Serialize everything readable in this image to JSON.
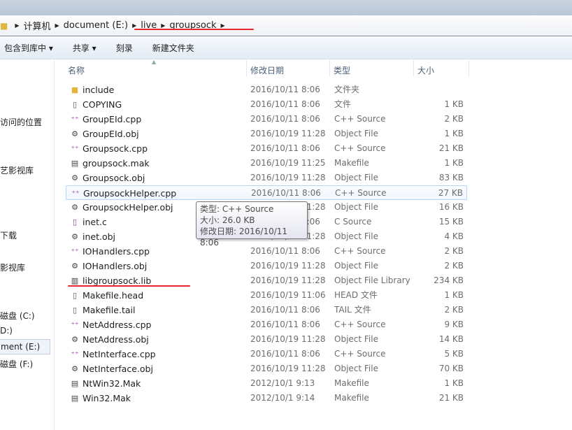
{
  "breadcrumb": [
    "计算机",
    "document (E:)",
    "live",
    "groupsock"
  ],
  "toolbar": {
    "include_library": "包含到库中 ▾",
    "share": "共享 ▾",
    "burn": "刻录",
    "new_folder": "新建文件夹"
  },
  "nav": [
    "访问的位置",
    "艺影视库",
    "下载",
    "影视库",
    "磁盘 (C:)",
    "D:)",
    "ment (E:)",
    "磁盘 (F:)"
  ],
  "columns": {
    "name": "名称",
    "date": "修改日期",
    "type": "类型",
    "size": "大小"
  },
  "files": [
    {
      "icon": "folder",
      "name": "include",
      "date": "2016/10/11 8:06",
      "type": "文件夹",
      "size": ""
    },
    {
      "icon": "file",
      "name": "COPYING",
      "date": "2016/10/11 8:06",
      "type": "文件",
      "size": "1 KB"
    },
    {
      "icon": "cpp",
      "name": "GroupEId.cpp",
      "date": "2016/10/11 8:06",
      "type": "C++ Source",
      "size": "2 KB"
    },
    {
      "icon": "obj",
      "name": "GroupEId.obj",
      "date": "2016/10/19 11:28",
      "type": "Object File",
      "size": "1 KB"
    },
    {
      "icon": "cpp",
      "name": "Groupsock.cpp",
      "date": "2016/10/11 8:06",
      "type": "C++ Source",
      "size": "21 KB"
    },
    {
      "icon": "mak",
      "name": "groupsock.mak",
      "date": "2016/10/19 11:25",
      "type": "Makefile",
      "size": "1 KB"
    },
    {
      "icon": "obj",
      "name": "Groupsock.obj",
      "date": "2016/10/19 11:28",
      "type": "Object File",
      "size": "83 KB"
    },
    {
      "icon": "cpp",
      "name": "GroupsockHelper.cpp",
      "date": "2016/10/11 8:06",
      "type": "C++ Source",
      "size": "27 KB"
    },
    {
      "icon": "obj",
      "name": "GroupsockHelper.obj",
      "date": "2016/10/19 11:28",
      "type": "Object File",
      "size": "16 KB"
    },
    {
      "icon": "c",
      "name": "inet.c",
      "date": "2016/10/11 8:06",
      "type": "C Source",
      "size": "15 KB"
    },
    {
      "icon": "obj",
      "name": "inet.obj",
      "date": "2016/10/19 11:28",
      "type": "Object File",
      "size": "4 KB"
    },
    {
      "icon": "cpp",
      "name": "IOHandlers.cpp",
      "date": "2016/10/11 8:06",
      "type": "C++ Source",
      "size": "2 KB"
    },
    {
      "icon": "obj",
      "name": "IOHandlers.obj",
      "date": "2016/10/19 11:28",
      "type": "Object File",
      "size": "2 KB"
    },
    {
      "icon": "lib",
      "name": "libgroupsock.lib",
      "date": "2016/10/19 11:28",
      "type": "Object File Library",
      "size": "234 KB"
    },
    {
      "icon": "file",
      "name": "Makefile.head",
      "date": "2016/10/19 11:06",
      "type": "HEAD 文件",
      "size": "1 KB"
    },
    {
      "icon": "file",
      "name": "Makefile.tail",
      "date": "2016/10/11 8:06",
      "type": "TAIL 文件",
      "size": "2 KB"
    },
    {
      "icon": "cpp",
      "name": "NetAddress.cpp",
      "date": "2016/10/11 8:06",
      "type": "C++ Source",
      "size": "9 KB"
    },
    {
      "icon": "obj",
      "name": "NetAddress.obj",
      "date": "2016/10/19 11:28",
      "type": "Object File",
      "size": "14 KB"
    },
    {
      "icon": "cpp",
      "name": "NetInterface.cpp",
      "date": "2016/10/11 8:06",
      "type": "C++ Source",
      "size": "5 KB"
    },
    {
      "icon": "obj",
      "name": "NetInterface.obj",
      "date": "2016/10/19 11:28",
      "type": "Object File",
      "size": "70 KB"
    },
    {
      "icon": "mak",
      "name": "NtWin32.Mak",
      "date": "2012/10/1 9:13",
      "type": "Makefile",
      "size": "1 KB"
    },
    {
      "icon": "mak",
      "name": "Win32.Mak",
      "date": "2012/10/1 9:14",
      "type": "Makefile",
      "size": "21 KB"
    }
  ],
  "tooltip": {
    "type": "类型: C++ Source",
    "size": "大小: 26.0 KB",
    "date": "修改日期: 2016/10/11 8:06"
  },
  "colors": {
    "annotation": "#e8262e",
    "hover": "#b8d6fb"
  }
}
